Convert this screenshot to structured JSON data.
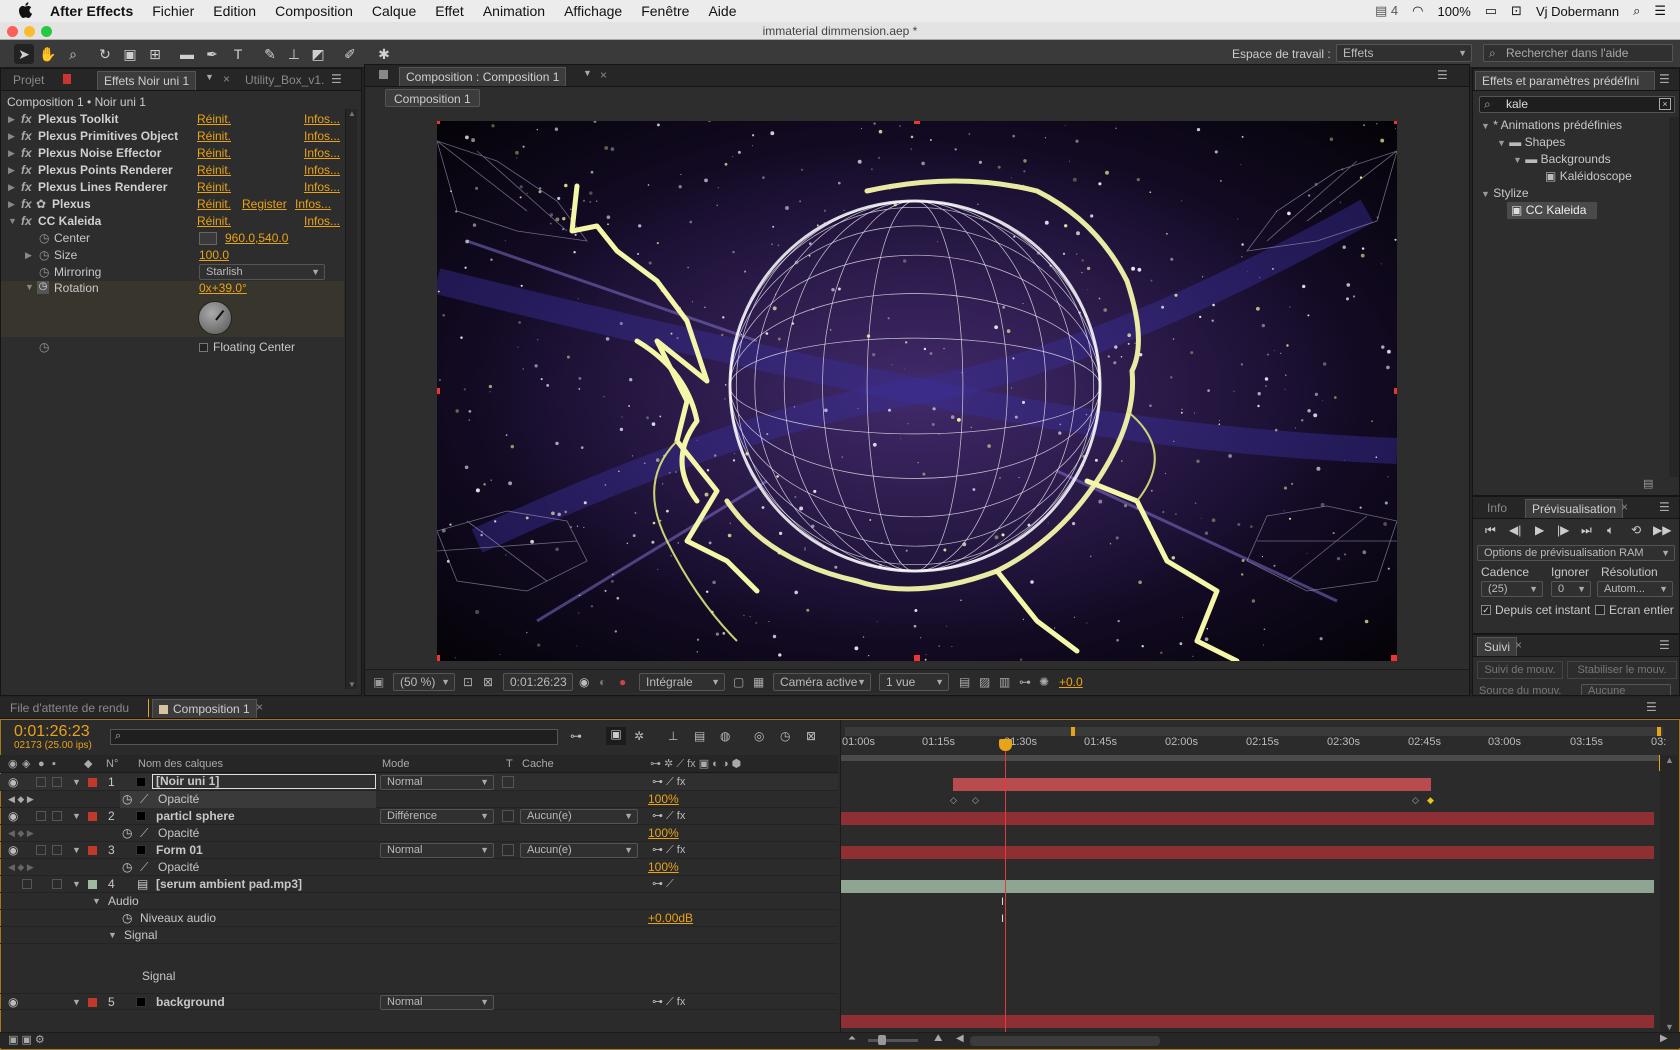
{
  "menubar": {
    "app": "After Effects",
    "items": [
      "Fichier",
      "Edition",
      "Composition",
      "Calque",
      "Effet",
      "Animation",
      "Affichage",
      "Fenêtre",
      "Aide"
    ],
    "status": {
      "notif_count": "4",
      "battery": "100%",
      "user": "Vj Dobermann"
    }
  },
  "window": {
    "title": "immaterial dimmension.aep *"
  },
  "toolbar": {
    "workspace_label": "Espace de travail :",
    "workspace_value": "Effets",
    "search_placeholder": "Rechercher dans l'aide"
  },
  "left_panel": {
    "tabs": [
      "Projet",
      "Effets Noir uni 1",
      "Utility_Box_v1."
    ],
    "breadcrumb": "Composition 1 • Noir uni 1",
    "effects": [
      {
        "name": "Plexus Toolkit",
        "reset": "Réinit.",
        "infos": "Infos..."
      },
      {
        "name": "Plexus Primitives Object",
        "reset": "Réinit.",
        "infos": "Infos..."
      },
      {
        "name": "Plexus Noise Effector",
        "reset": "Réinit.",
        "infos": "Infos..."
      },
      {
        "name": "Plexus Points Renderer",
        "reset": "Réinit.",
        "infos": "Infos..."
      },
      {
        "name": "Plexus Lines Renderer",
        "reset": "Réinit.",
        "infos": "Infos..."
      },
      {
        "name": "Plexus",
        "reset": "Réinit.",
        "register": "Register",
        "infos": "Infos..."
      },
      {
        "name": "CC Kaleida",
        "reset": "Réinit.",
        "infos": "Infos..."
      }
    ],
    "kaleida": {
      "center_label": "Center",
      "center_value": "960.0,540.0",
      "size_label": "Size",
      "size_value": "100.0",
      "mirroring_label": "Mirroring",
      "mirroring_value": "Starlish",
      "rotation_label": "Rotation",
      "rotation_value": "0x+39.0°",
      "floating_center": "Floating Center"
    }
  },
  "viewer": {
    "tab": "Composition : Composition 1",
    "crumb": "Composition 1",
    "zoom": "(50 %)",
    "timecode": "0:01:26:23",
    "quality": "Intégrale",
    "camera": "Caméra active",
    "views": "1 vue",
    "exposure": "+0.0"
  },
  "right_panel": {
    "effects_title": "Effets et paramètres prédéfini",
    "search_value": "kale",
    "tree": [
      {
        "label": "* Animations prédéfinies",
        "level": 0,
        "type": "folder-open"
      },
      {
        "label": "Shapes",
        "level": 1,
        "type": "folder"
      },
      {
        "label": "Backgrounds",
        "level": 2,
        "type": "folder"
      },
      {
        "label": "Kaléidoscope",
        "level": 3,
        "type": "preset"
      },
      {
        "label": "Stylize",
        "level": 0,
        "type": "folder-open"
      },
      {
        "label": "CC Kaleida",
        "level": 1,
        "type": "effect",
        "selected": true
      }
    ],
    "preview_tabs": [
      "Info",
      "Prévisualisation"
    ],
    "ram_options": "Options de prévisualisation RAM",
    "cadence_label": "Cadence",
    "cadence_value": "(25)",
    "ignore_label": "Ignorer",
    "ignore_value": "0",
    "resolution_label": "Résolution",
    "resolution_value": "Autom...",
    "from_current": "Depuis cet instant",
    "fullscreen": "Ecran entier",
    "suivi_tab": "Suivi",
    "track_motion": "Suivi de mouv.",
    "stabilize": "Stabiliser le mouv.",
    "source_label": "Source du mouv.",
    "source_value": "Aucune"
  },
  "timeline": {
    "tabs": [
      "File d'attente de rendu",
      "Composition 1"
    ],
    "timecode": "0:01:26:23",
    "frames": "02173 (25.00 ips)",
    "headers": {
      "num": "N°",
      "name": "Nom des calques",
      "mode": "Mode",
      "t": "T",
      "cache": "Cache"
    },
    "ruler": [
      "01:00s",
      "01:15s",
      "01:30s",
      "01:45s",
      "02:00s",
      "02:15s",
      "02:30s",
      "02:45s",
      "03:00s",
      "03:15s",
      "03:"
    ],
    "layers": [
      {
        "num": "1",
        "name": "[Noir uni 1]",
        "mode": "Normal",
        "cache": "",
        "prop": "Opacité",
        "prop_value": "100%",
        "color": "#c0392b"
      },
      {
        "num": "2",
        "name": "particl sphere",
        "mode": "Différence",
        "cache": "Aucun(e)",
        "prop": "Opacité",
        "prop_value": "100%",
        "color": "#c0392b"
      },
      {
        "num": "3",
        "name": "Form 01",
        "mode": "Normal",
        "cache": "Aucun(e)",
        "prop": "Opacité",
        "prop_value": "100%",
        "color": "#c0392b"
      },
      {
        "num": "4",
        "name": "[serum ambient pad.mp3]",
        "audio": "Audio",
        "audio_level_label": "Niveaux audio",
        "audio_level": "+0.00dB",
        "signal": "Signal",
        "signal2": "Signal",
        "color": "#9fb8a0"
      },
      {
        "num": "5",
        "name": "background",
        "mode": "Normal",
        "color": "#c0392b"
      }
    ]
  },
  "colors": {
    "accent": "#e8a317",
    "layer_bar": "#8e2f33",
    "audio_bar": "#8fa593",
    "playhead": "#e33b3b"
  }
}
